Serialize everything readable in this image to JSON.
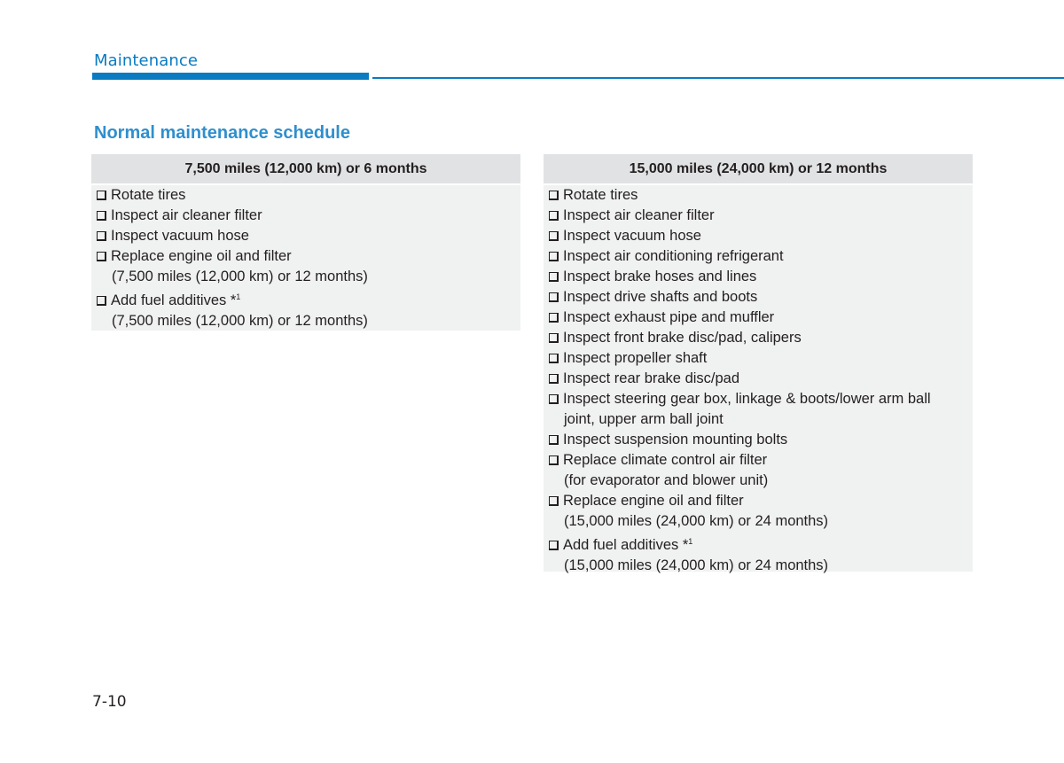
{
  "header": {
    "section": "Maintenance",
    "accent_color": "#0a7bc1"
  },
  "title": "Normal maintenance schedule",
  "schedules": [
    {
      "heading": "7,500 miles (12,000 km) or 6 months",
      "items": [
        {
          "text": "Rotate tires",
          "note": "",
          "sup": ""
        },
        {
          "text": "Inspect air cleaner filter",
          "note": "",
          "sup": ""
        },
        {
          "text": "Inspect vacuum hose",
          "note": "",
          "sup": ""
        },
        {
          "text": "Replace engine oil and filter",
          "note": "(7,500 miles (12,000 km) or 12 months)",
          "sup": ""
        },
        {
          "text": "Add fuel additives *",
          "note": "(7,500 miles (12,000 km) or 12 months)",
          "sup": "1"
        }
      ]
    },
    {
      "heading": "15,000 miles (24,000 km) or 12 months",
      "items": [
        {
          "text": "Rotate tires",
          "note": "",
          "sup": ""
        },
        {
          "text": "Inspect air cleaner filter",
          "note": "",
          "sup": ""
        },
        {
          "text": "Inspect vacuum hose",
          "note": "",
          "sup": ""
        },
        {
          "text": "Inspect air conditioning refrigerant",
          "note": "",
          "sup": ""
        },
        {
          "text": "Inspect brake hoses and lines",
          "note": "",
          "sup": ""
        },
        {
          "text": "Inspect drive shafts and boots",
          "note": "",
          "sup": ""
        },
        {
          "text": "Inspect exhaust pipe and muffler",
          "note": "",
          "sup": ""
        },
        {
          "text": "Inspect front brake disc/pad, calipers",
          "note": "",
          "sup": ""
        },
        {
          "text": "Inspect propeller shaft",
          "note": "",
          "sup": ""
        },
        {
          "text": "Inspect rear brake disc/pad",
          "note": "",
          "sup": ""
        },
        {
          "text": "Inspect steering gear box, linkage & boots/lower arm ball",
          "note": "joint, upper arm ball joint",
          "sup": ""
        },
        {
          "text": "Inspect suspension mounting bolts",
          "note": "",
          "sup": ""
        },
        {
          "text": "Replace climate control air filter",
          "note": "(for evaporator and blower unit)",
          "sup": ""
        },
        {
          "text": "Replace engine oil and filter",
          "note": "(15,000 miles (24,000 km) or 24 months)",
          "sup": ""
        },
        {
          "text": "Add fuel additives *",
          "note": "(15,000 miles (24,000 km) or 24 months)",
          "sup": "1"
        }
      ]
    }
  ],
  "footer": {
    "page_number": "7-10"
  }
}
